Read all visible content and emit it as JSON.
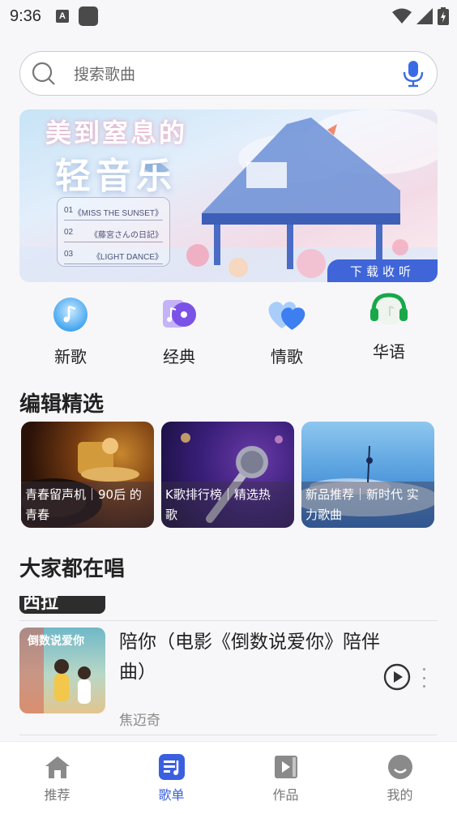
{
  "status_bar": {
    "time": "9:36",
    "notif_letter": "A"
  },
  "search": {
    "placeholder": "搜索歌曲"
  },
  "banner": {
    "title_line1": "美到窒息的",
    "title_line2": "轻音乐",
    "tracks": [
      {
        "num": "01",
        "name": "《MISS THE SUNSET》"
      },
      {
        "num": "02",
        "name": "《藤宮さんの日記》"
      },
      {
        "num": "03",
        "name": "《LIGHT DANCE》"
      }
    ],
    "cta": "下载收听"
  },
  "categories": [
    {
      "label": "新歌",
      "icon": "new-songs-icon"
    },
    {
      "label": "经典",
      "icon": "classics-icon"
    },
    {
      "label": "情歌",
      "icon": "love-songs-icon"
    },
    {
      "label": "华语",
      "icon": "chinese-songs-icon"
    }
  ],
  "editor_picks": {
    "title": "编辑精选",
    "playlists": [
      {
        "line1": "青春留声机｜90后 的",
        "line2": "青春"
      },
      {
        "line1": "K歌排行榜｜精选热",
        "line2": "歌"
      },
      {
        "line1": "新品推荐｜新时代 实",
        "line2": "力歌曲"
      }
    ]
  },
  "everyone_sings": {
    "title": "大家都在唱",
    "partial_cover_text": "西拉",
    "songs": [
      {
        "title": "陪你（电影《倒数说爱你》陪伴曲）",
        "artist": "焦迈奇",
        "cover_text": "倒数说爱你"
      }
    ]
  },
  "tabbar": {
    "tabs": [
      {
        "label": "推荐",
        "icon": "home-icon",
        "active": false
      },
      {
        "label": "歌单",
        "icon": "playlist-icon",
        "active": true
      },
      {
        "label": "作品",
        "icon": "works-icon",
        "active": false
      },
      {
        "label": "我的",
        "icon": "profile-icon",
        "active": false
      }
    ]
  },
  "colors": {
    "accent": "#3a5fe0",
    "banner_cta": "#3f65d8",
    "mic": "#3a6be6",
    "background": "#f7f7f9"
  }
}
